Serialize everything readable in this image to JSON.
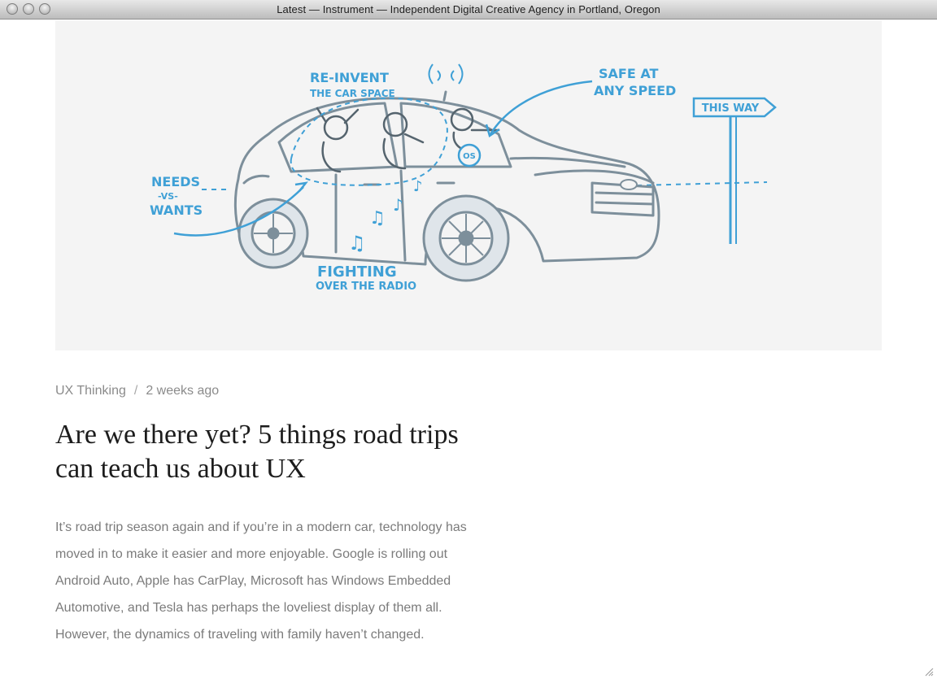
{
  "window": {
    "title": "Latest — Instrument — Independent Digital Creative Agency in Portland, Oregon"
  },
  "hero": {
    "annotations": {
      "reinvent_1": "RE-INVENT",
      "reinvent_2": "THE CAR SPACE",
      "safe_1": "SAFE AT",
      "safe_2": "ANY SPEED",
      "sign": "THIS WAY",
      "needs_1": "NEEDS",
      "needs_2": "-VS-",
      "needs_3": "WANTS",
      "fighting_1": "FIGHTING",
      "fighting_2": "OVER THE RADIO",
      "os_badge": "OS"
    },
    "colors": {
      "background": "#f4f4f4",
      "ink": "#7d8f9b",
      "accent": "#3fa0d6"
    }
  },
  "post": {
    "category": "UX Thinking",
    "separator": "/",
    "date": "2 weeks ago",
    "title": "Are we there yet? 5 things road trips can teach us about UX",
    "excerpt": "It’s road trip season again and if you’re in a modern car, technology has moved in to make it easier and more enjoyable. Google is rolling out Android Auto, Apple has CarPlay, Microsoft has Windows Embedded Automotive, and Tesla has perhaps the loveliest display of them all. However, the dynamics of traveling with family haven’t changed."
  }
}
